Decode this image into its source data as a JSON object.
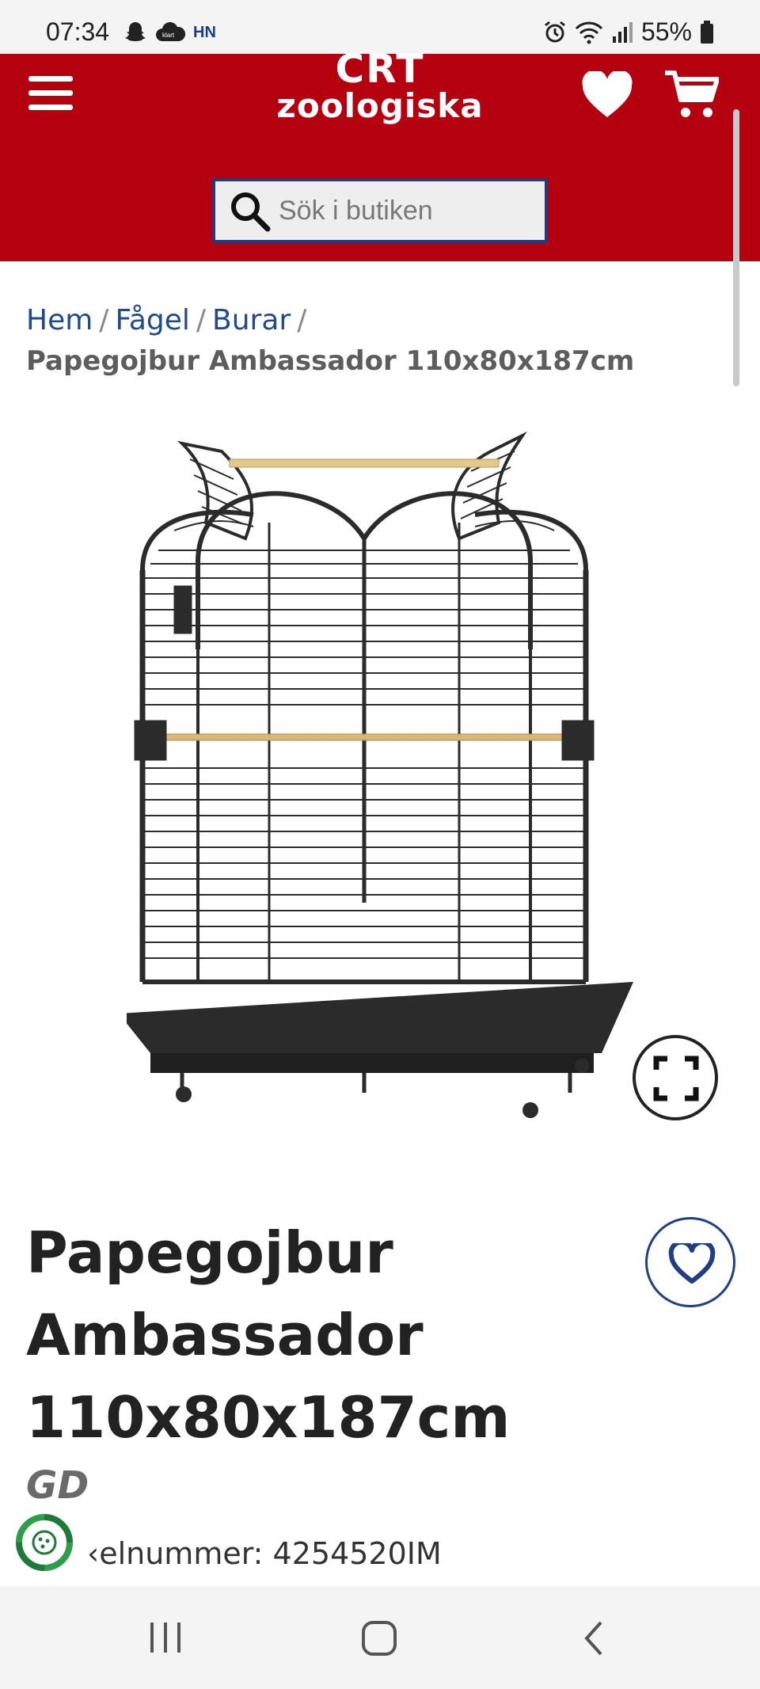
{
  "status_bar": {
    "time": "07:34",
    "carrier_badge": "HN",
    "battery": "55%"
  },
  "header": {
    "logo_top": "CRT",
    "logo_bottom": "zoologiska",
    "brand_color": "#b5000f",
    "search": {
      "placeholder": "Sök i butiken"
    }
  },
  "breadcrumb": {
    "items": [
      "Hem",
      "Fågel",
      "Burar"
    ],
    "separator": "/",
    "current": "Papegojbur Ambassador 110x80x187cm"
  },
  "product": {
    "title": "Papegojbur Ambassador 110x80x187cm",
    "brand": "GD",
    "article_label": "Artikelnummer:",
    "article_number": "4254520IM",
    "article_visible": "‹elnummer: 4254520IM",
    "image_icon": "parrot-cage-image"
  },
  "icons": {
    "menu": "hamburger-icon",
    "wishlist": "heart-icon",
    "cart": "cart-icon",
    "search": "search-icon",
    "expand": "fullscreen-icon"
  }
}
